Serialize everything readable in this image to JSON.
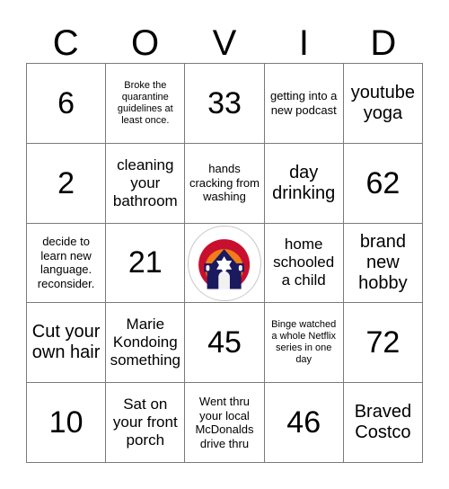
{
  "header": {
    "letters": [
      "C",
      "O",
      "V",
      "I",
      "D"
    ]
  },
  "colors": {
    "grid_line": "#7a7a7a",
    "text": "#000000",
    "background": "#ffffff",
    "logo_outer_arc": "#c8102e",
    "logo_mid_arc": "#f07d1a",
    "logo_inner_arc": "#f6c244",
    "logo_building": "#1b1a5e",
    "logo_accent": "#f1f1f1"
  },
  "grid": {
    "rows": [
      [
        {
          "text": "6",
          "size": "size-num",
          "type": "number"
        },
        {
          "text": "Broke the quarantine guidelines at least once.",
          "size": "size-xs",
          "type": "prompt"
        },
        {
          "text": "33",
          "size": "size-num",
          "type": "number"
        },
        {
          "text": "getting into a new podcast",
          "size": "size-sm",
          "type": "prompt"
        },
        {
          "text": "youtube yoga",
          "size": "size-lg",
          "type": "prompt"
        }
      ],
      [
        {
          "text": "2",
          "size": "size-num",
          "type": "number"
        },
        {
          "text": "cleaning your bathroom",
          "size": "size-md",
          "type": "prompt"
        },
        {
          "text": "hands cracking from washing",
          "size": "size-sm",
          "type": "prompt"
        },
        {
          "text": "day drinking",
          "size": "size-lg",
          "type": "prompt"
        },
        {
          "text": "62",
          "size": "size-num",
          "type": "number"
        }
      ],
      [
        {
          "text": "decide to learn new language. reconsider.",
          "size": "size-sm",
          "type": "prompt"
        },
        {
          "text": "21",
          "size": "size-num",
          "type": "number"
        },
        {
          "text": "",
          "size": "size-md",
          "type": "free-space-logo"
        },
        {
          "text": "home schooled a child",
          "size": "size-md",
          "type": "prompt"
        },
        {
          "text": "brand new hobby",
          "size": "size-lg",
          "type": "prompt"
        }
      ],
      [
        {
          "text": "Cut your own hair",
          "size": "size-lg",
          "type": "prompt"
        },
        {
          "text": "Marie Kondoing something",
          "size": "size-md",
          "type": "prompt"
        },
        {
          "text": "45",
          "size": "size-num",
          "type": "number"
        },
        {
          "text": "Binge watched a whole Netflix series in one day",
          "size": "size-xs",
          "type": "prompt"
        },
        {
          "text": "72",
          "size": "size-num",
          "type": "number"
        }
      ],
      [
        {
          "text": "10",
          "size": "size-num",
          "type": "number"
        },
        {
          "text": "Sat on your front porch",
          "size": "size-md",
          "type": "prompt"
        },
        {
          "text": "Went thru your local McDonalds drive thru",
          "size": "size-sm",
          "type": "prompt"
        },
        {
          "text": "46",
          "size": "size-num",
          "type": "number"
        },
        {
          "text": "Braved Costco",
          "size": "size-lg",
          "type": "prompt"
        }
      ]
    ]
  },
  "free_space": {
    "icon_name": "synagogue-rainbow-logo",
    "description": "circular badge with rainbow arc over navy building with star of david"
  }
}
